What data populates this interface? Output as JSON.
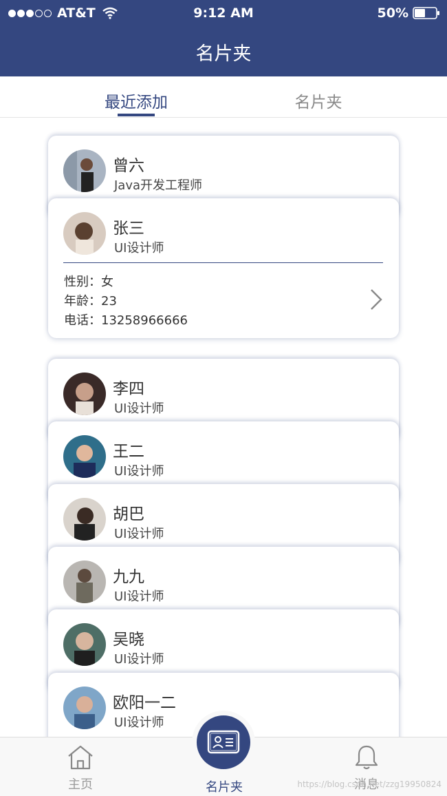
{
  "status_bar": {
    "carrier": "AT&T",
    "time": "9:12 AM",
    "battery": "50%"
  },
  "nav": {
    "title": "名片夹"
  },
  "tabs": [
    {
      "label": "最近添加",
      "active": true
    },
    {
      "label": "名片夹",
      "active": false
    }
  ],
  "expanded_card": {
    "name": "张三",
    "title": "UI设计师",
    "details": [
      "性别：女",
      "年龄：23",
      "电话：13258966666"
    ]
  },
  "cards_group1": [
    {
      "name": "曾六",
      "title": "Java开发工程师"
    }
  ],
  "cards_group2": [
    {
      "name": "李四",
      "title": "UI设计师"
    },
    {
      "name": "王二",
      "title": "UI设计师"
    },
    {
      "name": "胡巴",
      "title": "UI设计师"
    },
    {
      "name": "九九",
      "title": "UI设计师"
    },
    {
      "name": "吴晓",
      "title": "UI设计师"
    },
    {
      "name": "欧阳一二",
      "title": "UI设计师"
    }
  ],
  "bottom_nav": {
    "home": "主页",
    "cards": "名片夹",
    "messages": "消息"
  },
  "watermark": "https://blog.csdn.net/zzg19950824",
  "colors": {
    "primary": "#344780"
  }
}
